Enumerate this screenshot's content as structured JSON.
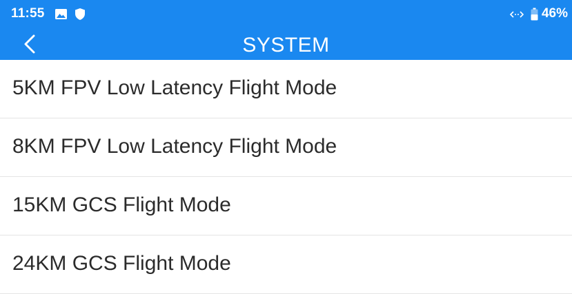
{
  "status_bar": {
    "time": "11:55",
    "battery": "46%",
    "icons": [
      "gallery-icon",
      "shield-icon",
      "link-icon",
      "battery-icon"
    ],
    "background_color": "#1a88f0"
  },
  "header": {
    "title": "SYSTEM",
    "back_icon": "chevron-left-icon"
  },
  "modes": [
    {
      "label": "5KM FPV Low Latency Flight Mode"
    },
    {
      "label": "8KM FPV Low Latency Flight Mode"
    },
    {
      "label": "15KM GCS Flight Mode"
    },
    {
      "label": "24KM GCS Flight Mode"
    }
  ]
}
